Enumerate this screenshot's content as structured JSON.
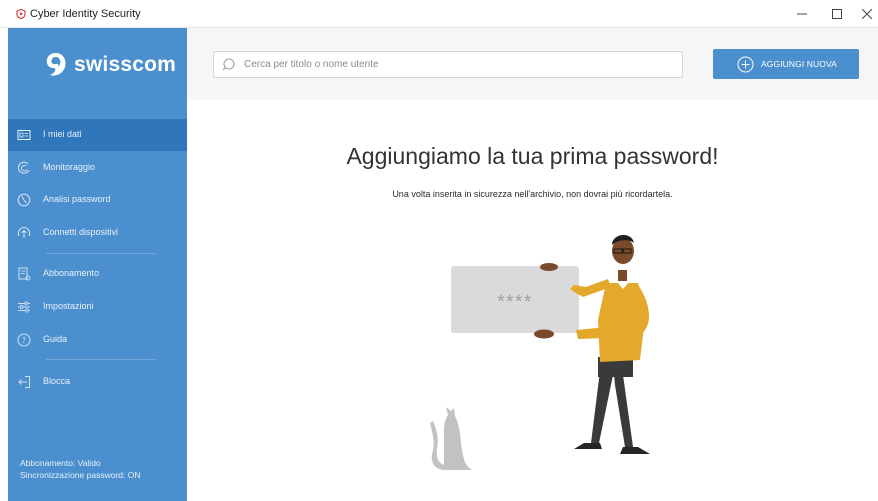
{
  "window": {
    "title": "Cyber Identity Security",
    "controls": [
      "minimize-icon",
      "maximize-icon",
      "close-icon"
    ]
  },
  "sidebar": {
    "logo_text": "swisscom",
    "items": [
      {
        "label": "I miei dati",
        "icon": "id-card-icon",
        "active": true
      },
      {
        "label": "Monitoraggio",
        "icon": "monitor-icon",
        "active": false
      },
      {
        "label": "Analisi password",
        "icon": "gauge-icon",
        "active": false
      },
      {
        "label": "Connetti dispositivi",
        "icon": "devices-icon",
        "active": false
      },
      {
        "label": "Abbonamento",
        "icon": "subscription-icon",
        "active": false
      },
      {
        "label": "Impostazioni",
        "icon": "settings-sliders-icon",
        "active": false
      },
      {
        "label": "Guida",
        "icon": "help-icon",
        "active": false
      },
      {
        "label": "Blocca",
        "icon": "lock-exit-icon",
        "active": false
      }
    ],
    "status": {
      "subscription": "Abbonamento: Valido",
      "sync": "Sincronizzazione password: ON"
    }
  },
  "header": {
    "search": {
      "placeholder": "Cerca per titolo o nome utente",
      "value": ""
    },
    "add_button_label": "AGGIUNGI NUOVA"
  },
  "main": {
    "title": "Aggiungiamo la tua prima password!",
    "subtitle": "Una volta inserita in sicurezza nell'archivio, non dovrai più ricordartela.",
    "card_text": "****"
  },
  "colors": {
    "sidebar": "#4b8fcf",
    "sidebar_active": "#2f76bb",
    "accent": "#4b8fcf",
    "header_bg": "#f6f6f6"
  }
}
